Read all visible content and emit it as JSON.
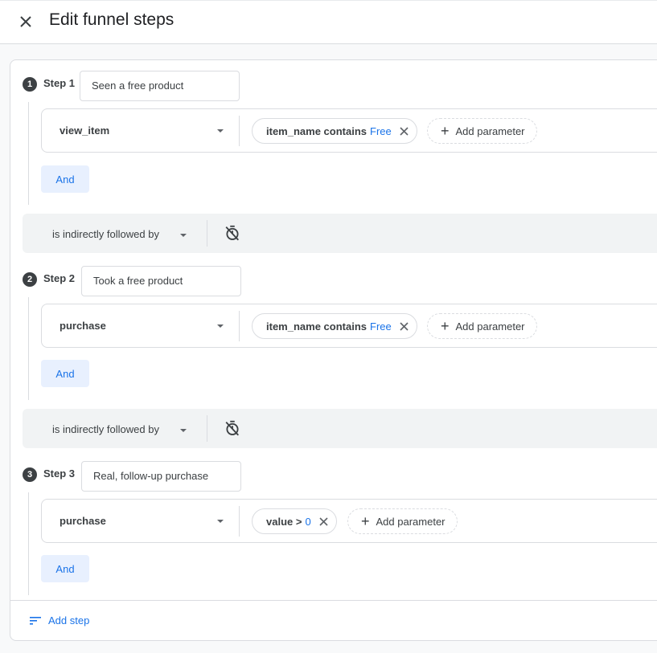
{
  "header": {
    "title": "Edit funnel steps",
    "close_icon": "close-icon"
  },
  "steps": [
    {
      "number": "1",
      "label": "Step 1",
      "name": "Seen a free product",
      "event": "view_item",
      "conditions": [
        {
          "param": "item_name contains",
          "value": "Free"
        }
      ],
      "add_parameter_label": "Add parameter",
      "and_label": "And"
    },
    {
      "number": "2",
      "label": "Step 2",
      "name": "Took a free product",
      "event": "purchase",
      "conditions": [
        {
          "param": "item_name contains",
          "value": "Free"
        }
      ],
      "add_parameter_label": "Add parameter",
      "and_label": "And"
    },
    {
      "number": "3",
      "label": "Step 3",
      "name": "Real, follow-up purchase",
      "event": "purchase",
      "conditions": [
        {
          "param": "value >",
          "value": "0"
        }
      ],
      "add_parameter_label": "Add parameter",
      "and_label": "And"
    }
  ],
  "followers": [
    {
      "label": "is indirectly followed by",
      "timer_icon": "timer-off-icon"
    },
    {
      "label": "is indirectly followed by",
      "timer_icon": "timer-off-icon"
    }
  ],
  "footer": {
    "add_step_label": "Add step",
    "add_step_icon": "sort-lines-icon"
  },
  "colors": {
    "accent": "#1a73e8",
    "chip_bg": "#e8f0fe",
    "follow_bg": "#f1f3f4",
    "border": "#dadce0",
    "page_bg": "#f8f9fa"
  }
}
